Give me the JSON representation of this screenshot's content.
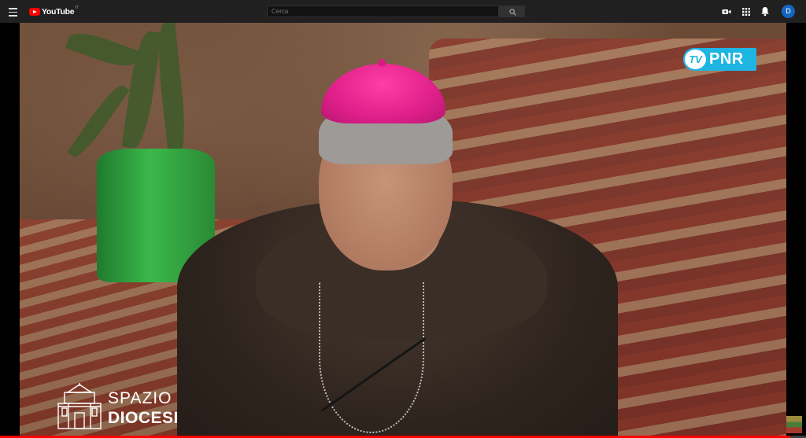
{
  "header": {
    "logo_text": "YouTube",
    "logo_region": "IT",
    "search": {
      "placeholder": "Cerca",
      "value": "Cerca"
    },
    "avatar_letter": "D",
    "icons": [
      "menu-icon",
      "youtube-logo-icon",
      "search-icon",
      "create-video-icon",
      "apps-grid-icon",
      "notifications-bell-icon"
    ]
  },
  "video": {
    "channel_bug": {
      "tv": "TV",
      "name": "PNR"
    },
    "program_logo": {
      "line1": "SPAZIO",
      "line2": "DIOCESI"
    },
    "progress_fraction": 0.98
  },
  "colors": {
    "topbar_bg": "#202020",
    "youtube_red": "#ff0000",
    "tvpnr_blue": "#1fb5e3",
    "zucchetto_magenta": "#e0208a",
    "avatar_blue": "#1565c0"
  }
}
